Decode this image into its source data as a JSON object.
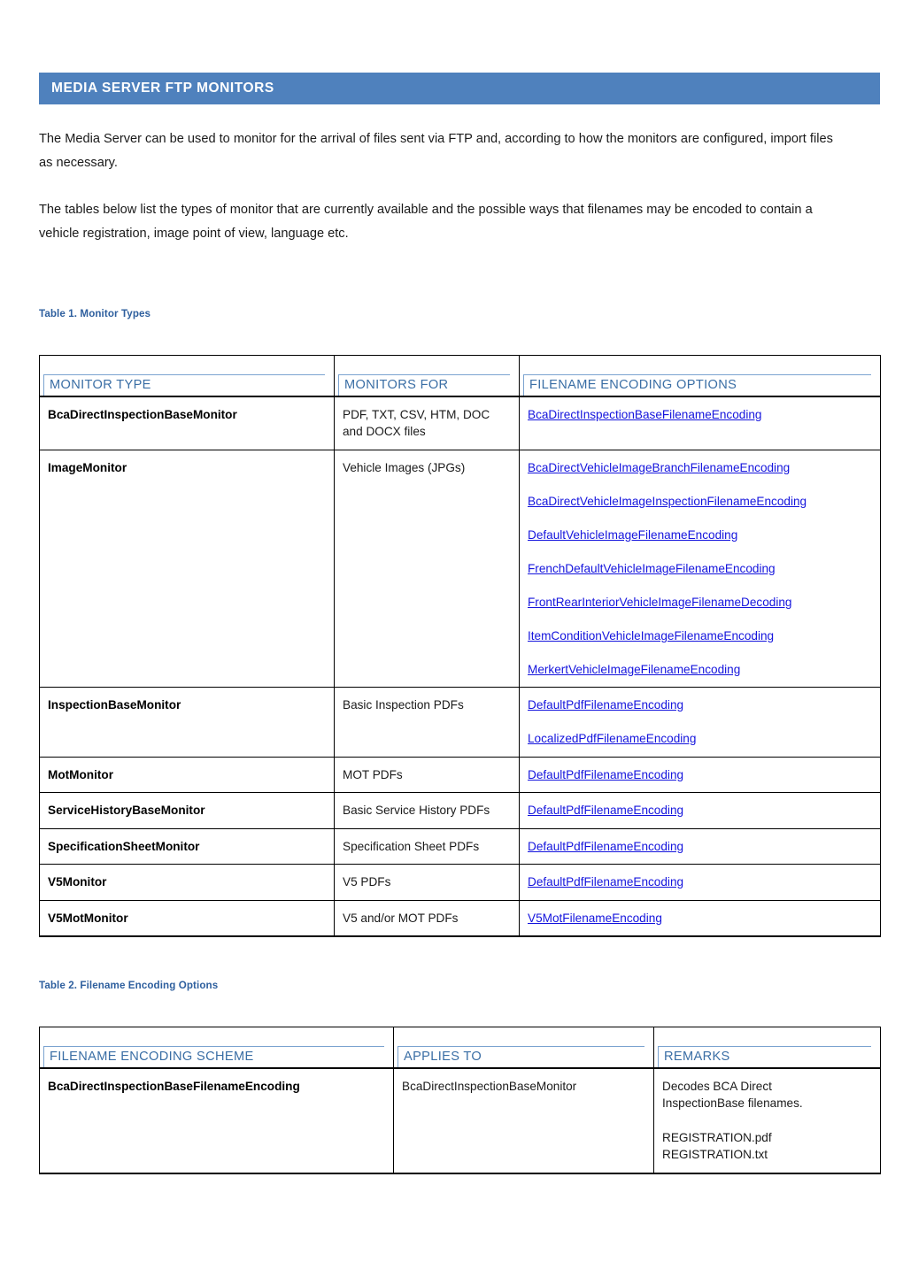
{
  "banner": {
    "title": "MEDIA SERVER FTP MONITORS",
    "color": "#4f81bd"
  },
  "intro": {
    "paragraph_1": "The Media Server can be used to monitor for the arrival of files sent via FTP and, according to how the monitors are configured, import files as necessary.",
    "paragraph_2": "The tables below list the types of monitor that are currently available and the possible ways that filenames may be encoded to contain a vehicle registration, image point of view, language etc."
  },
  "theme": {
    "heading_blue": "#3a6ea5",
    "caption_blue": "#2e5f9e",
    "accent_rule": "#7ba3d0",
    "link_blue": "#1414dd"
  },
  "table1": {
    "caption": "Table 1. Monitor Types",
    "headers": [
      "MONITOR TYPE",
      "MONITORS FOR",
      "FILENAME ENCODING OPTIONS"
    ],
    "rows": [
      {
        "monitor_type": "BcaDirectInspectionBaseMonitor",
        "monitors_for": "PDF, TXT, CSV, HTM, DOC and DOCX files",
        "encodings": [
          "BcaDirectInspectionBaseFilenameEncoding"
        ]
      },
      {
        "monitor_type": "ImageMonitor",
        "monitors_for": "Vehicle Images (JPGs)",
        "encodings": [
          "BcaDirectVehicleImageBranchFilenameEncoding",
          "BcaDirectVehicleImageInspectionFilenameEncoding",
          "DefaultVehicleImageFilenameEncoding",
          "FrenchDefaultVehicleImageFilenameEncoding",
          "FrontRearInteriorVehicleImageFilenameDecoding",
          "ItemConditionVehicleImageFilenameEncoding",
          "MerkertVehicleImageFilenameEncoding"
        ]
      },
      {
        "monitor_type": "InspectionBaseMonitor",
        "monitors_for": "Basic Inspection PDFs",
        "encodings": [
          "DefaultPdfFilenameEncoding",
          "LocalizedPdfFilenameEncoding"
        ]
      },
      {
        "monitor_type": "MotMonitor",
        "monitors_for": "MOT PDFs",
        "encodings": [
          "DefaultPdfFilenameEncoding"
        ]
      },
      {
        "monitor_type": "ServiceHistoryBaseMonitor",
        "monitors_for": "Basic Service History PDFs",
        "encodings": [
          "DefaultPdfFilenameEncoding"
        ]
      },
      {
        "monitor_type": "SpecificationSheetMonitor",
        "monitors_for": "Specification Sheet PDFs",
        "encodings": [
          "DefaultPdfFilenameEncoding"
        ]
      },
      {
        "monitor_type": "V5Monitor",
        "monitors_for": "V5 PDFs",
        "encodings": [
          "DefaultPdfFilenameEncoding"
        ]
      },
      {
        "monitor_type": "V5MotMonitor",
        "monitors_for": "V5 and/or MOT PDFs",
        "encodings": [
          "V5MotFilenameEncoding"
        ]
      }
    ]
  },
  "table2": {
    "caption": "Table 2. Filename Encoding Options",
    "headers": [
      "FILENAME ENCODING SCHEME",
      "APPLIES TO",
      "REMARKS"
    ],
    "rows": [
      {
        "scheme": "BcaDirectInspectionBaseFilenameEncoding",
        "applies_to": "BcaDirectInspectionBaseMonitor",
        "remarks": [
          "Decodes BCA Direct",
          "InspectionBase filenames.",
          "",
          "REGISTRATION.pdf",
          "REGISTRATION.txt"
        ]
      }
    ]
  }
}
